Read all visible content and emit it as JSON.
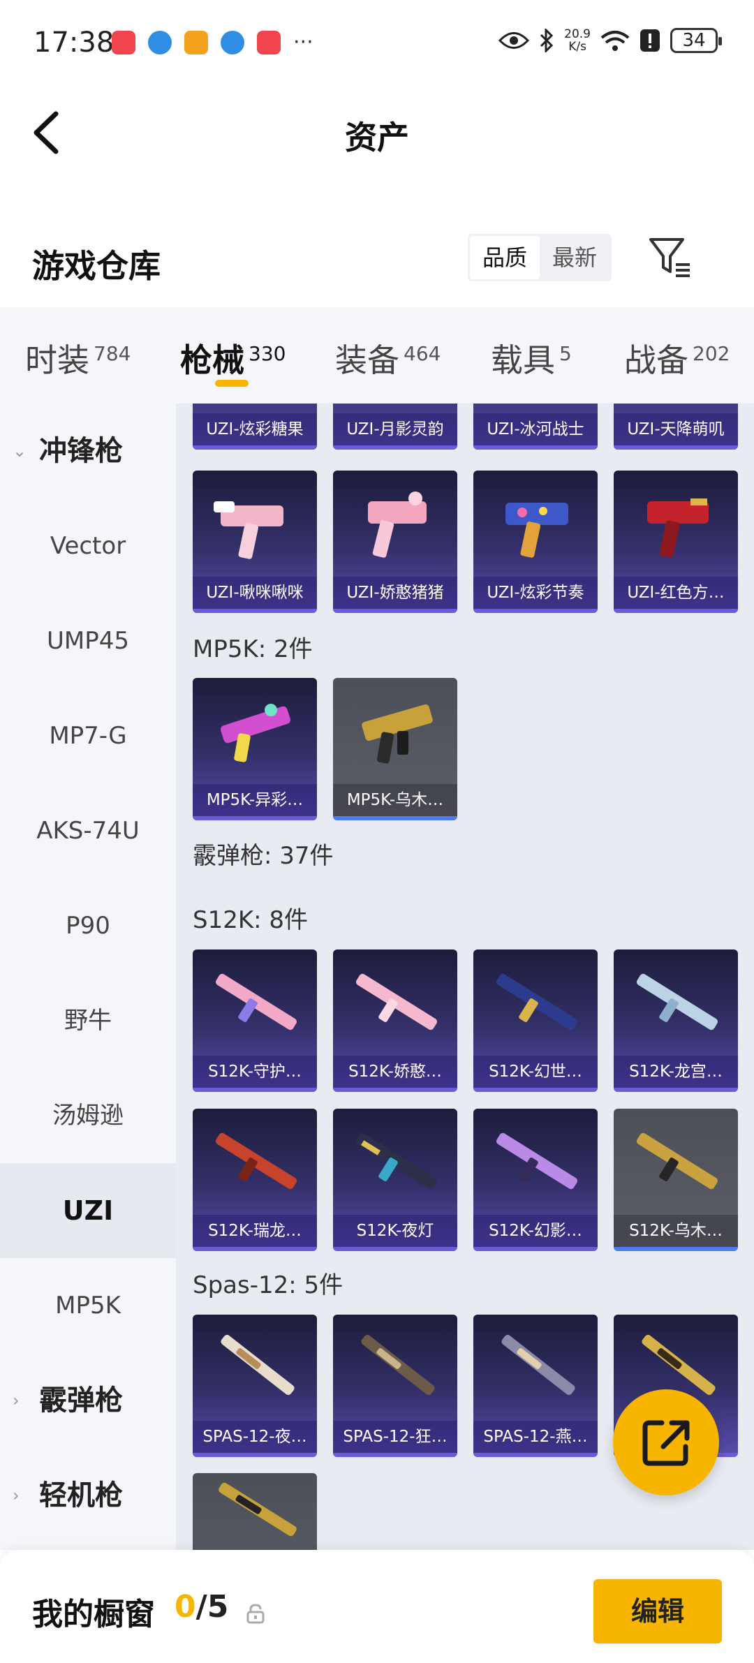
{
  "status_bar": {
    "time": "17:38",
    "net_speed_value": "20.9",
    "net_speed_unit": "K/s",
    "battery": "34",
    "more": "···"
  },
  "header": {
    "title": "资产"
  },
  "warehouse": {
    "title": "游戏仓库",
    "sort_options": [
      "品质",
      "最新"
    ],
    "sort_selected": "品质"
  },
  "category_tabs": [
    {
      "label": "时装",
      "count": "784"
    },
    {
      "label": "枪械",
      "count": "330",
      "active": true
    },
    {
      "label": "装备",
      "count": "464"
    },
    {
      "label": "载具",
      "count": "5"
    },
    {
      "label": "战备",
      "count": "202"
    }
  ],
  "sidebar": {
    "items": [
      {
        "label": "冲锋枪",
        "type": "group",
        "expanded": true
      },
      {
        "label": "Vector"
      },
      {
        "label": "UMP45"
      },
      {
        "label": "MP7-G"
      },
      {
        "label": "AKS-74U"
      },
      {
        "label": "P90"
      },
      {
        "label": "野牛"
      },
      {
        "label": "汤姆逊"
      },
      {
        "label": "UZI",
        "active": true
      },
      {
        "label": "MP5K"
      },
      {
        "label": "霰弹枪",
        "type": "group",
        "expanded": false
      },
      {
        "label": "轻机枪",
        "type": "group",
        "expanded": false
      }
    ]
  },
  "content": {
    "uzi_row1": [
      "UZI-炫彩糖果",
      "UZI-月影灵韵",
      "UZI-冰河战士",
      "UZI-天降萌叽"
    ],
    "uzi_row2": [
      "UZI-啾咪啾咪",
      "UZI-娇憨猪猪",
      "UZI-炫彩节奏",
      "UZI-红色方…"
    ],
    "mp5k_label": "MP5K: 2件",
    "mp5k_items": [
      "MP5K-异彩…",
      "MP5K-乌木…"
    ],
    "shotgun_label": "霰弹枪: 37件",
    "s12k_label": "S12K: 8件",
    "s12k_row1": [
      "S12K-守护…",
      "S12K-娇憨…",
      "S12K-幻世…",
      "S12K-龙宫…"
    ],
    "s12k_row2": [
      "S12K-瑞龙…",
      "S12K-夜灯",
      "S12K-幻影…",
      "S12K-乌木…"
    ],
    "spas_label": "Spas-12: 5件",
    "spas_row1": [
      "SPAS-12-夜…",
      "SPAS-12-狂…",
      "SPAS-12-燕…"
    ]
  },
  "bottom_bar": {
    "title": "我的橱窗",
    "count_current": "0",
    "count_sep": "/",
    "count_max": "5",
    "edit_label": "编辑"
  },
  "colors": {
    "accent": "#f7b500",
    "card_purple_top": "#1c1c3a",
    "card_purple_bottom": "#5b4eb0",
    "card_gray": "#5d5f68"
  }
}
